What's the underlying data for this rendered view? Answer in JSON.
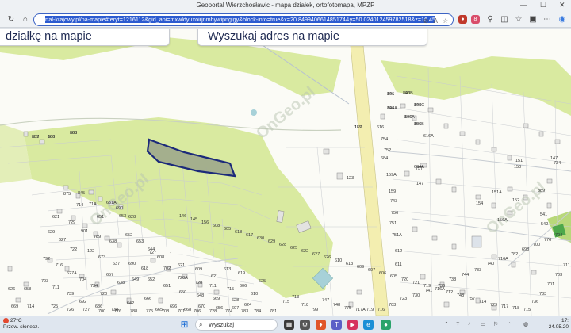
{
  "browser": {
    "window_title": "Geoportal Wierzchosławic - mapa działek, ortofotomapa, MPZP",
    "url": "rtal-krajowy.pl/na-mapie#teryt=1216112&gid_api=mxwldyuxoirjnmhywipngigy&block-info=true&x=20.849940661485174&y=50.024012459782518&z=16.45",
    "profile_label": "8"
  },
  "page": {
    "btn_left_label": "działkę na mapie",
    "btn_right_label": "Wyszukaj adres na mapie"
  },
  "map": {
    "watermark": "OnGeo.pl",
    "plot_labels": [
      "896",
      "896B",
      "896A",
      "896C",
      "896",
      "896B",
      "887",
      "888",
      "888",
      "119",
      "616",
      "616A",
      "754",
      "752",
      "684",
      "684A",
      "159A",
      "757",
      "159",
      "743",
      "756",
      "751",
      "751A",
      "123",
      "612",
      "611",
      "147",
      "151",
      "151A",
      "152",
      "150",
      "154",
      "156A",
      "541",
      "542",
      "147",
      "734",
      "889",
      "875",
      "845",
      "714",
      "71A",
      "651",
      "651A",
      "690",
      "653",
      "628",
      "621",
      "729",
      "901",
      "789",
      "638",
      "652",
      "653",
      "644",
      "608",
      "727",
      "1",
      "621",
      "609",
      "621",
      "613",
      "619",
      "122",
      "673",
      "637",
      "690",
      "618",
      "702",
      "720A",
      "728",
      "711",
      "715",
      "606",
      "657",
      "638",
      "649",
      "652",
      "651",
      "650",
      "648",
      "669",
      "628",
      "629",
      "627",
      "722",
      "792",
      "716",
      "627A",
      "704",
      "734",
      "720",
      "703",
      "711",
      "739",
      "692",
      "636",
      "738",
      "642",
      "666",
      "665",
      "696",
      "668",
      "670",
      "656",
      "607",
      "624",
      "610",
      "625",
      "626",
      "658",
      "669",
      "714",
      "725",
      "726",
      "727",
      "700",
      "776",
      "788",
      "775",
      "708",
      "701",
      "706",
      "728",
      "774",
      "783",
      "784",
      "781",
      "715",
      "713",
      "718",
      "799",
      "747",
      "748",
      "775",
      "717A",
      "719",
      "716",
      "703",
      "723",
      "730",
      "741",
      "736",
      "738",
      "744",
      "733",
      "740",
      "716A",
      "782",
      "698",
      "700",
      "776",
      "704",
      "711",
      "703",
      "701",
      "733",
      "736",
      "715",
      "718",
      "717",
      "729",
      "714",
      "757",
      "748",
      "712",
      "716A",
      "719",
      "721",
      "720",
      "605",
      "606",
      "607",
      "609",
      "613",
      "610",
      "626",
      "627",
      "622",
      "625",
      "628",
      "629",
      "630",
      "617",
      "618",
      "605",
      "608",
      "156",
      "145",
      "146",
      "141",
      "140",
      "144",
      "143",
      "146A",
      "156",
      "153",
      "165",
      "166",
      "167"
    ]
  },
  "taskbar": {
    "weather_temp": "27°C",
    "weather_desc": "Przew. słonecz.",
    "search_placeholder": "Wyszukaj",
    "time": "17:",
    "date": "24.05.20"
  },
  "colors": {
    "accent": "#3b63c4",
    "map_green": "#d9eaa0",
    "plot_outline": "#1c2a7a",
    "plot_fill": "#9aa58a",
    "road_yellow": "#f3eeb0"
  }
}
